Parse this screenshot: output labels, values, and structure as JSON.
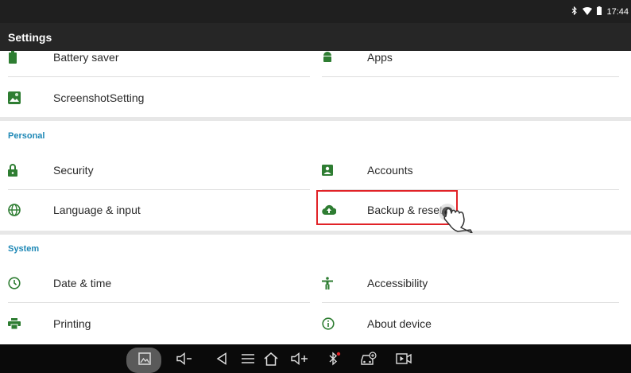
{
  "status_bar": {
    "time": "17:44",
    "icons": [
      "bluetooth-icon",
      "wifi-icon",
      "battery-icon"
    ]
  },
  "header": {
    "title": "Settings"
  },
  "device_section": {
    "items": [
      {
        "label": "Battery saver",
        "icon": "battery-icon"
      },
      {
        "label": "Apps",
        "icon": "android-icon"
      },
      {
        "label": "ScreenshotSetting",
        "icon": "image-icon"
      }
    ]
  },
  "personal": {
    "title": "Personal",
    "items": [
      {
        "label": "Security",
        "icon": "lock-icon"
      },
      {
        "label": "Accounts",
        "icon": "account-icon"
      },
      {
        "label": "Language & input",
        "icon": "globe-icon"
      },
      {
        "label": "Backup & reset",
        "icon": "cloud-upload-icon"
      }
    ]
  },
  "system": {
    "title": "System",
    "items": [
      {
        "label": "Date & time",
        "icon": "clock-icon"
      },
      {
        "label": "Accessibility",
        "icon": "accessibility-icon"
      },
      {
        "label": "Printing",
        "icon": "printer-icon"
      },
      {
        "label": "About device",
        "icon": "info-icon"
      }
    ]
  },
  "nav_bar": {
    "buttons": [
      "screenshot-icon",
      "volume-down-icon",
      "back-icon",
      "menu-icon",
      "home-icon",
      "volume-up-icon",
      "bluetooth-icon",
      "vehicle-diagnostic-icon",
      "screen-record-icon"
    ]
  },
  "colors": {
    "accent": "#1e88b6",
    "icon": "#2e7d32",
    "highlight": "#e12227",
    "status_bar": "#1f1f1f",
    "title_bar": "#262626"
  }
}
